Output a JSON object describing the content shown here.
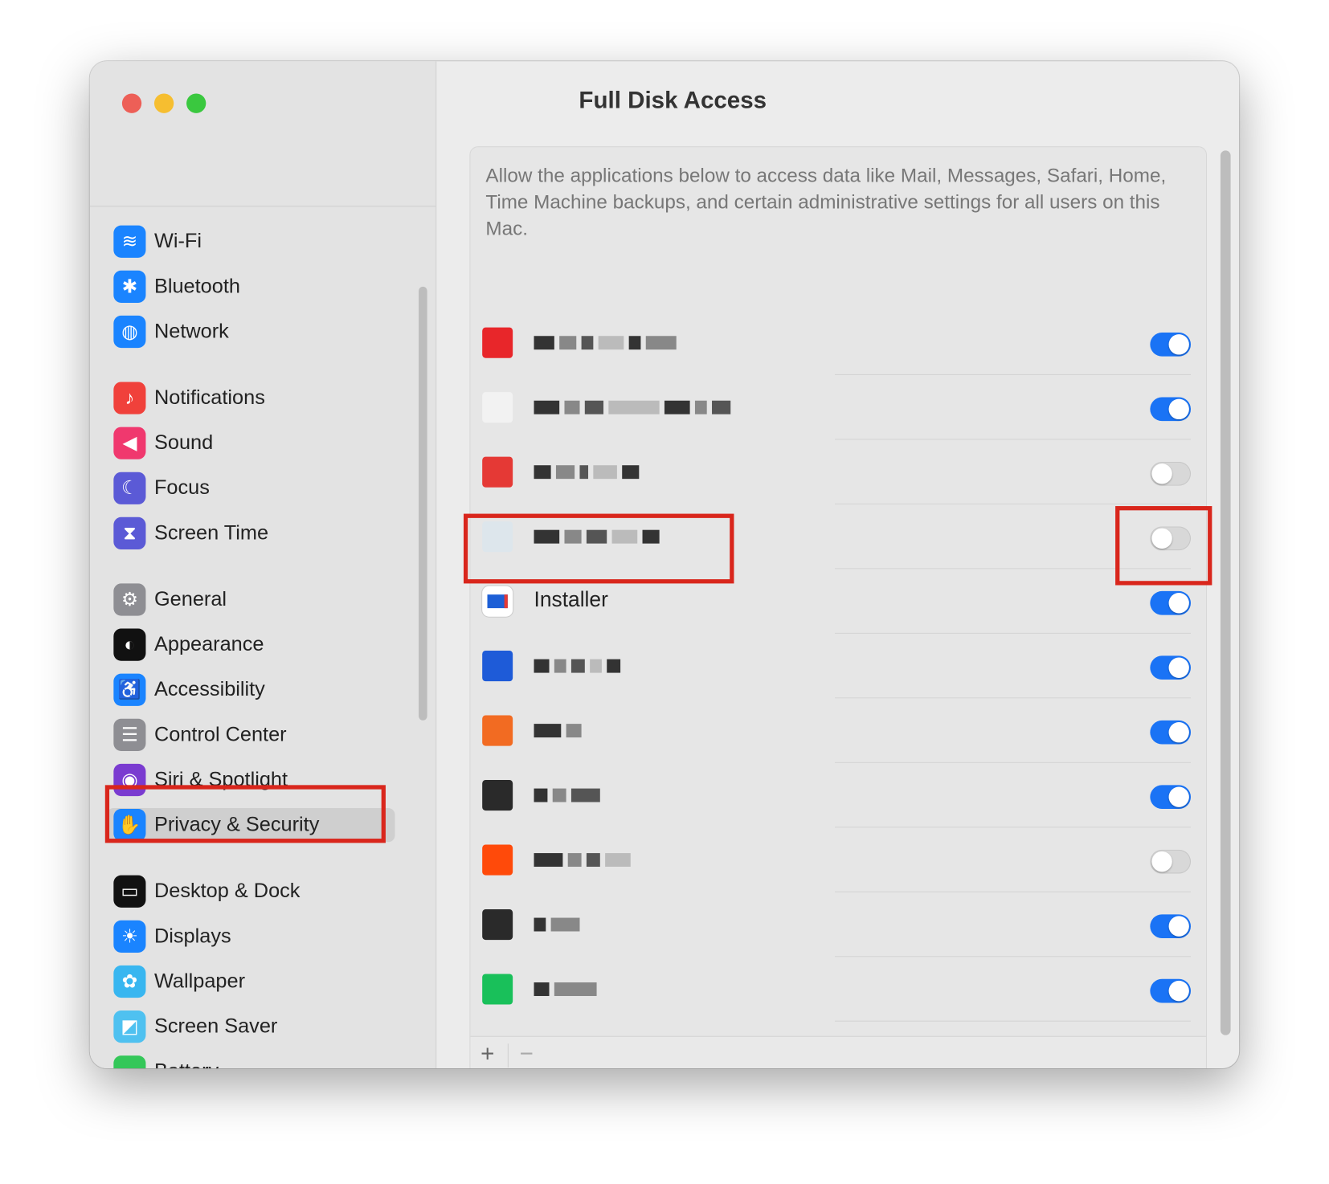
{
  "window": {
    "title": "Full Disk Access",
    "traffic_lights": {
      "close": "#ed5f57",
      "minimize": "#f6be30",
      "zoom": "#3ac83f"
    }
  },
  "sidebar": {
    "selected": "Privacy & Security",
    "items": [
      {
        "label": "Wi-Fi",
        "icon": "wifi-icon",
        "color": "#1a84ff",
        "glyph": "≋"
      },
      {
        "label": "Bluetooth",
        "icon": "bluetooth-icon",
        "color": "#1a84ff",
        "glyph": "✱"
      },
      {
        "label": "Network",
        "icon": "globe-icon",
        "color": "#1a84ff",
        "glyph": "◍"
      },
      {
        "label": "Notifications",
        "icon": "bell-icon",
        "color": "#f0413b",
        "glyph": "♪"
      },
      {
        "label": "Sound",
        "icon": "speaker-icon",
        "color": "#f0386e",
        "glyph": "◀"
      },
      {
        "label": "Focus",
        "icon": "moon-icon",
        "color": "#5b5ad6",
        "glyph": "☾"
      },
      {
        "label": "Screen Time",
        "icon": "hourglass-icon",
        "color": "#5b5ad6",
        "glyph": "⧗"
      },
      {
        "label": "General",
        "icon": "gear-icon",
        "color": "#8e8e93",
        "glyph": "⚙"
      },
      {
        "label": "Appearance",
        "icon": "appearance-icon",
        "color": "#111111",
        "glyph": "◐"
      },
      {
        "label": "Accessibility",
        "icon": "accessibility-icon",
        "color": "#1a84ff",
        "glyph": "♿"
      },
      {
        "label": "Control Center",
        "icon": "switches-icon",
        "color": "#8e8e93",
        "glyph": "☰"
      },
      {
        "label": "Siri & Spotlight",
        "icon": "siri-icon",
        "color": "#7a3bd0",
        "glyph": "◉"
      },
      {
        "label": "Privacy & Security",
        "icon": "hand-icon",
        "color": "#1a84ff",
        "glyph": "✋"
      },
      {
        "label": "Desktop & Dock",
        "icon": "dock-icon",
        "color": "#111111",
        "glyph": "▭"
      },
      {
        "label": "Displays",
        "icon": "sun-icon",
        "color": "#1a84ff",
        "glyph": "☀"
      },
      {
        "label": "Wallpaper",
        "icon": "flower-icon",
        "color": "#38b6f0",
        "glyph": "✿"
      },
      {
        "label": "Screen Saver",
        "icon": "screensaver-icon",
        "color": "#4fc1f0",
        "glyph": "◩"
      },
      {
        "label": "Battery",
        "icon": "battery-icon",
        "color": "#34c759",
        "glyph": "▬"
      }
    ]
  },
  "main": {
    "description": "Allow the applications below to access data like Mail, Messages, Safari, Home, Time Machine backups, and certain administrative settings for all users on this Mac.",
    "apps": [
      {
        "name": null,
        "enabled": true
      },
      {
        "name": null,
        "enabled": true
      },
      {
        "name": null,
        "enabled": false
      },
      {
        "name": null,
        "enabled": false
      },
      {
        "name": "Installer",
        "enabled": true
      },
      {
        "name": null,
        "enabled": true
      },
      {
        "name": null,
        "enabled": true
      },
      {
        "name": null,
        "enabled": true
      },
      {
        "name": null,
        "enabled": false
      },
      {
        "name": null,
        "enabled": true
      },
      {
        "name": null,
        "enabled": true
      },
      {
        "name": null,
        "enabled": true
      }
    ],
    "add_label": "+",
    "remove_label": "−"
  },
  "highlight_color": "#d9261c",
  "toggle_on_color": "#1a73f5"
}
